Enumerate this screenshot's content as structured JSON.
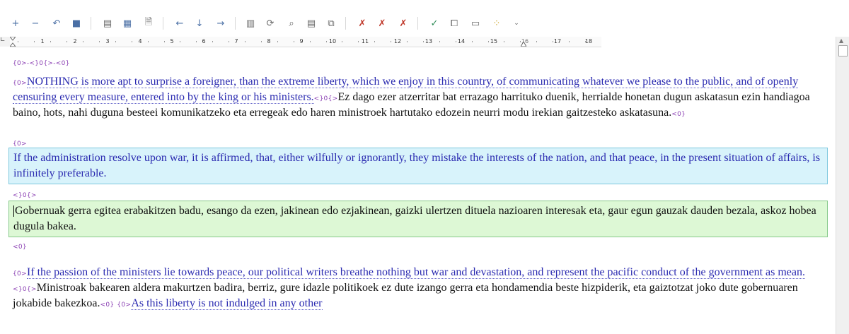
{
  "toolbar": {
    "icons": [
      "plus-icon",
      "minus-icon",
      "undo-icon",
      "stop-icon",
      "document-icon",
      "table-icon",
      "file-check-icon",
      "arrow-left-icon",
      "arrow-down-icon",
      "arrow-right-icon",
      "grid-icon",
      "refresh-icon",
      "search-icon",
      "list-icon",
      "copy-icon",
      "delete-file-icon",
      "delete-search-icon",
      "delete-list-icon",
      "check-icon",
      "crop-icon",
      "window-icon",
      "dots-icon",
      "overflow-icon"
    ],
    "glyphs": {
      "plus": "+",
      "minus": "−",
      "undo": "↶",
      "stop": "■",
      "document": "▤",
      "table": "▦",
      "filecheck": "🗎",
      "left": "←",
      "down": "↓",
      "right": "→",
      "grid": "▥",
      "refresh": "⟳",
      "search": "⌕",
      "list": "▤",
      "copy": "⧉",
      "delfile": "✗",
      "delsearch": "✗",
      "dellist": "✗",
      "check": "✓",
      "crop": "⧠",
      "window": "▭",
      "dots": "⁘",
      "more": "⌄"
    }
  },
  "ruler": {
    "numbers": [
      "1",
      "2",
      "3",
      "4",
      "5",
      "6",
      "7",
      "8",
      "9",
      "10",
      "11",
      "12",
      "13",
      "14",
      "15",
      "16",
      "17",
      "18"
    ]
  },
  "document": {
    "tags_top": "{0>-<}0{>-<0}",
    "p1_tag_open": "{0>",
    "p1_source": "NOTHING is more apt to surprise a foreigner, than the extreme liberty, which we enjoy in this country, of communicating whatever we please to the public, and of openly censuring every measure, entered into by the king or his ministers.",
    "p1_tag_mid": "<}0{>",
    "p1_target": "Ez dago ezer atzerritar bat errazago harrituko duenik, herrialde honetan dugun askatasun ezin handiagoa baino, hots, nahi duguna besteei komunikatzeko eta erregeak edo haren ministroek hartutako edozein neurri modu irekian gaitzesteko askatasuna.",
    "p1_tag_close": "<0}",
    "p2_tag_open": "{0>",
    "p2_source": "If the administration resolve upon war, it is affirmed, that, either wilfully or ignorantly, they mistake the interests of the nation, and that peace, in the present situation of affairs, is infinitely preferable.",
    "p2_tag_mid": "<}0{>",
    "p2_target": "Gobernuak gerra egitea erabakitzen badu, esango da ezen, jakinean edo ezjakinean, gaizki ulertzen dituela nazioaren interesak eta, gaur egun gauzak dauden bezala, askoz hobea dugula bakea.",
    "p2_tag_close": "<0}",
    "p3_tag_open": "{0>",
    "p3_source": "If the passion of the ministers lie towards peace, our political writers breathe nothing but war and devastation, and represent the pacific conduct of the government as mean.",
    "p3_tag_mid": "<}0{>",
    "p3_target": "Ministroak bakearen aldera makurtzen badira, berriz, gure idazle politikoek ez dute izango gerra eta hondamendia beste hizpiderik, eta gaiztotzat joko dute gobernuaren jokabide bakezkoa.",
    "p3_tag_close": "<0}",
    "p4_tag_open": "{0>",
    "p4_source": "As this liberty is not indulged in any other"
  }
}
